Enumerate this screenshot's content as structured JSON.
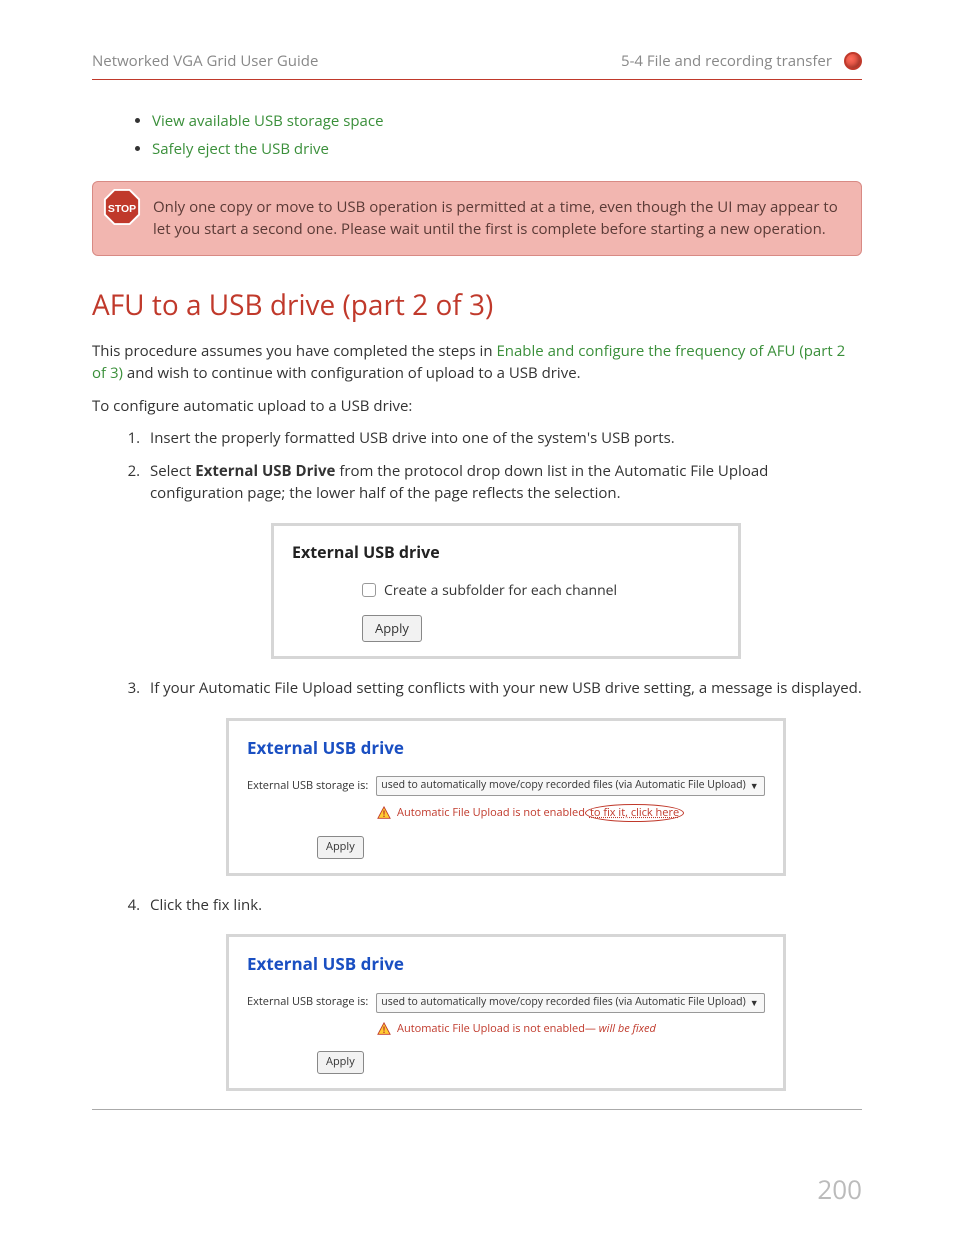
{
  "header": {
    "left": "Networked VGA Grid User Guide",
    "right": "5-4 File and recording transfer"
  },
  "links": [
    "View available USB storage space",
    "Safely eject the USB drive"
  ],
  "stop_text": "Only one copy or move to USB operation is permitted at a time, even though the UI may appear to let you start a second one. Please wait until the first is complete before starting a new operation.",
  "section_title": "AFU to a USB drive (part 2 of 3)",
  "intro_pre": "This procedure assumes you have completed the steps in ",
  "intro_link": "Enable and configure the frequency of AFU (part 2 of 3)",
  "intro_post": " and wish to continue with configuration of upload to a USB drive.",
  "intro2": "To configure automatic upload to a USB drive:",
  "step1": "Insert the properly formatted USB drive into one of the system's USB ports.",
  "step2_pre": "Select ",
  "step2_bold": "External USB Drive",
  "step2_post": " from the protocol drop down list in the Automatic File Upload configuration page; the lower half of the page reflects the selection.",
  "fig1": {
    "title": "External USB drive",
    "checkbox_label": "Create a subfolder for each channel",
    "apply": "Apply"
  },
  "step3": "If your Automatic File Upload setting conflicts with your new USB drive setting, a message is displayed.",
  "fig2": {
    "title": "External USB drive",
    "storage_label": "External USB storage is:",
    "select_value": "used to automatically move/copy recorded files (via Automatic File Upload)",
    "warn_pre": "Automatic File Upload is not enabled",
    "warn_link": " to fix it, click here",
    "apply": "Apply"
  },
  "step4": "Click the fix link.",
  "fig3": {
    "title": "External USB drive",
    "storage_label": "External USB storage is:",
    "select_value": "used to automatically move/copy recorded files (via Automatic File Upload)",
    "warn_pre": "Automatic File Upload is not enabled—",
    "warn_italic": " will be fixed",
    "apply": "Apply"
  },
  "page_number": "200"
}
